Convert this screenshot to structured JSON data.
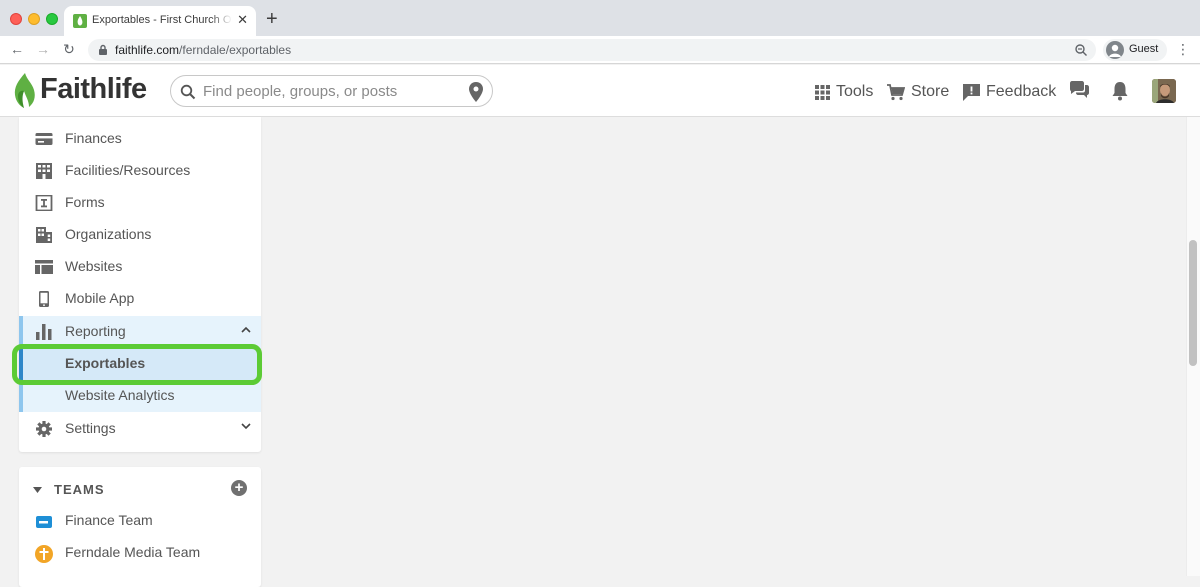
{
  "browser": {
    "tab_title": "Exportables - First Church Of Ferndale",
    "tab_close": "✕",
    "new_tab": "+",
    "url_domain": "faithlife.com",
    "url_path": "/ferndale/exportables",
    "profile_label": "Guest",
    "menu_glyph": "⋮",
    "back_glyph": "←",
    "forward_glyph": "→",
    "reload_glyph": "↻"
  },
  "header": {
    "logo_text": "Faithlife",
    "search_placeholder": "Find people, groups, or posts",
    "tools_label": "Tools",
    "store_label": "Store",
    "feedback_label": "Feedback"
  },
  "sidebar": {
    "items": [
      {
        "label": "Finances",
        "icon": "credit-card-icon"
      },
      {
        "label": "Facilities/Resources",
        "icon": "building-icon"
      },
      {
        "label": "Forms",
        "icon": "form-icon"
      },
      {
        "label": "Organizations",
        "icon": "organization-icon"
      },
      {
        "label": "Websites",
        "icon": "website-icon"
      },
      {
        "label": "Mobile App",
        "icon": "mobile-icon"
      },
      {
        "label": "Reporting",
        "icon": "bar-chart-icon",
        "expanded": true
      },
      {
        "label": "Exportables",
        "active": true
      },
      {
        "label": "Website Analytics"
      },
      {
        "label": "Settings",
        "icon": "gear-icon"
      }
    ]
  },
  "teams": {
    "title": "TEAMS",
    "add_glyph": "+",
    "items": [
      {
        "label": "Finance Team",
        "icon": "finance-team-icon"
      },
      {
        "label": "Ferndale Media Team",
        "icon": "media-team-icon"
      }
    ]
  },
  "colors": {
    "brand_green": "#5fb043",
    "highlight_green": "#5ccb35",
    "active_blue": "#2e86c8",
    "expanded_bg": "#e6f3fc"
  }
}
